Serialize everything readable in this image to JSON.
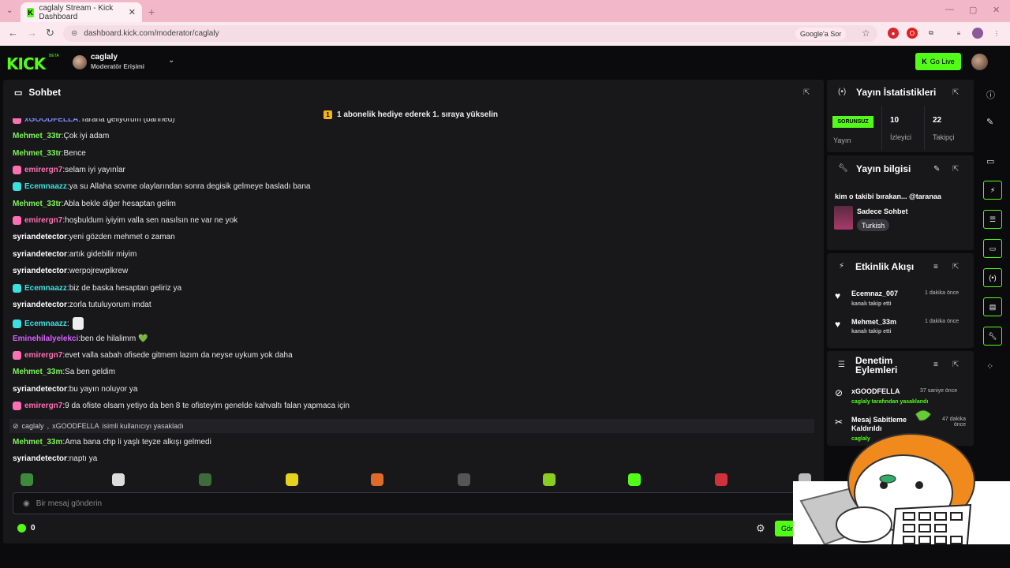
{
  "browser": {
    "tab_title": "caglaly Stream - Kick Dashboard",
    "url": "dashboard.kick.com/moderator/caglaly",
    "google_chip": "Google'a Sor"
  },
  "header": {
    "logo": "KICK",
    "beta": "BETA",
    "username": "caglaly",
    "role": "Moderatör Erişimi",
    "go_live": "Go Live"
  },
  "chat": {
    "title": "Sohbet",
    "pinned": "1 abonelik hediye ederek 1. sıraya yükselin",
    "messages": [
      {
        "user": "xGOODFELLA",
        "text": "Tarana geliyorum (banned)",
        "color": "b",
        "badge": "pink"
      },
      {
        "user": "Mehmet_33tr",
        "text": "Çok iyi adam",
        "color": "g",
        "badge": ""
      },
      {
        "user": "Mehmet_33tr",
        "text": "Bence",
        "color": "g",
        "badge": ""
      },
      {
        "user": "emirergn7",
        "text": "selam iyi yayınlar",
        "color": "p",
        "badge": "pink"
      },
      {
        "user": "Ecemnaazz",
        "text": "ya su Allaha sovme olaylarından sonra degisik gelmeye basladı bana",
        "color": "c",
        "badge": "cyan"
      },
      {
        "user": "Mehmet_33tr",
        "text": "Abla bekle diğer hesaptan gelim",
        "color": "g",
        "badge": ""
      },
      {
        "user": "emirergn7",
        "text": "hoşbuldum iyiyim valla sen nasılsın ne var ne yok",
        "color": "p",
        "badge": "pink"
      },
      {
        "user": "syriandetector",
        "text": "yeni gözden mehmet o zaman",
        "color": "w",
        "badge": ""
      },
      {
        "user": "syriandetector",
        "text": "artık gidebilir miyim",
        "color": "w",
        "badge": ""
      },
      {
        "user": "syriandetector",
        "text": "werpojrewplkrew",
        "color": "w",
        "badge": ""
      },
      {
        "user": "Ecemnaazz",
        "text": "biz de baska hesaptan geliriz ya",
        "color": "c",
        "badge": "cyan"
      },
      {
        "user": "syriandetector",
        "text": "zorla tutuluyorum imdat",
        "color": "w",
        "badge": ""
      },
      {
        "user": "Ecemnaazz",
        "text": "",
        "color": "c",
        "badge": "cyan"
      },
      {
        "user": "Eminehilalyelekci",
        "text": "ben de hilalimm 💚",
        "color": "m",
        "badge": ""
      },
      {
        "user": "emirergn7",
        "text": "evet valla sabah ofisede gitmem lazım da neyse uykum yok daha",
        "color": "p",
        "badge": "pink"
      },
      {
        "user": "Mehmet_33m",
        "text": "Sa ben geldim",
        "color": "g",
        "badge": ""
      },
      {
        "user": "syriandetector",
        "text": "bu yayın noluyor ya",
        "color": "w",
        "badge": ""
      },
      {
        "user": "emirergn7",
        "text": "9 da ofiste olsam yetiyo da ben 8 te ofisteyim genelde kahvaltı falan yapmaca için",
        "color": "p",
        "badge": "pink"
      }
    ],
    "system": {
      "mod": "caglaly",
      "target": "xGOODFELLA",
      "text": "isimli kullanıcıyı yasakladı"
    },
    "after": [
      {
        "user": "Mehmet_33m",
        "text": "Ama bana chp li yaşlı teyze alkışı gelmedi",
        "color": "g",
        "badge": ""
      },
      {
        "user": "syriandetector",
        "text": "naptı ya",
        "color": "w",
        "badge": ""
      }
    ],
    "input_placeholder": "Bir mesaj gönderin",
    "points": "0",
    "send": "Gönder"
  },
  "stats": {
    "title": "Yayın İstatistikleri",
    "status": "SORUNSUZ",
    "status_label": "Yayın",
    "viewers": "10",
    "viewers_label": "İzleyici",
    "followers": "22",
    "followers_label": "Takipçi"
  },
  "info": {
    "title": "Yayın bilgisi",
    "stream_title": "kim o takibi bırakan... @taranaa",
    "category": "Sadece Sohbet",
    "tag": "Turkish"
  },
  "activity": {
    "title": "Etkinlik Akışı",
    "events": [
      {
        "name": "Ecemnaz_007",
        "sub": "kanalı takip etti",
        "time": "1 dakika önce"
      },
      {
        "name": "Mehmet_33m",
        "sub": "kanalı takip etti",
        "time": "1 dakika önce"
      }
    ]
  },
  "moderation": {
    "title_1": "Denetim",
    "title_2": "Eylemleri",
    "actions": [
      {
        "name": "xGOODFELLA",
        "sub": "caglaly tarafından yasaklandı",
        "time": "37 saniye önce"
      },
      {
        "name": "Mesaj Sabitleme Kaldırıldı",
        "sub": "caglaly",
        "time": "47 dakika önce"
      }
    ]
  }
}
